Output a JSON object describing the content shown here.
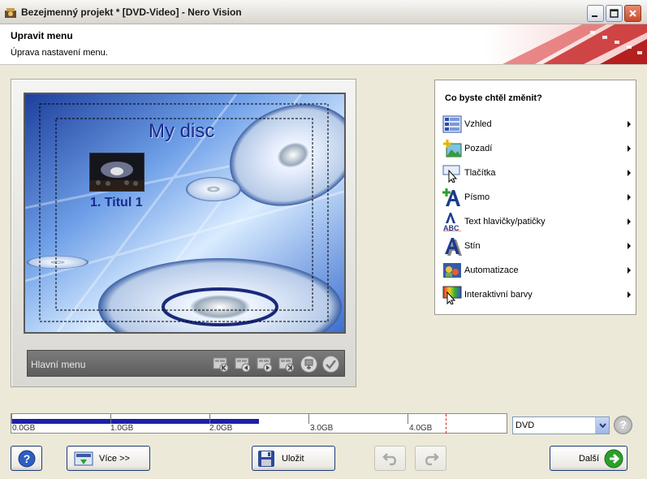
{
  "window": {
    "title": "Bezejmenný projekt * [DVD-Video] - Nero Vision"
  },
  "header": {
    "title": "Upravit menu",
    "subtitle": "Úprava nastavení menu."
  },
  "preview": {
    "disc_title": "My disc",
    "title_label": "1. Titul 1",
    "menu_label": "Hlavní menu"
  },
  "panel": {
    "heading": "Co byste chtěl změnit?",
    "items": [
      {
        "label": "Vzhled",
        "icon": "layout-icon"
      },
      {
        "label": "Pozadí",
        "icon": "background-icon"
      },
      {
        "label": "Tlačítka",
        "icon": "buttons-icon"
      },
      {
        "label": "Písmo",
        "icon": "font-icon"
      },
      {
        "label": "Text hlavičky/patičky",
        "icon": "header-footer-text-icon"
      },
      {
        "label": "Stín",
        "icon": "shadow-icon"
      },
      {
        "label": "Automatizace",
        "icon": "automation-icon"
      },
      {
        "label": "Interaktivní barvy",
        "icon": "interactive-colors-icon"
      }
    ]
  },
  "capacity": {
    "ticks": [
      "0.0GB",
      "1.0GB",
      "2.0GB",
      "3.0GB",
      "4.0GB"
    ],
    "used_fraction": 0.5,
    "disc_type": "DVD"
  },
  "buttons": {
    "more": "Více >>",
    "save": "Uložit",
    "next": "Další"
  },
  "colors": {
    "accent": "#1c1fa8",
    "capacity_limit": "#dd2211",
    "next_arrow": "#2aa02a"
  }
}
